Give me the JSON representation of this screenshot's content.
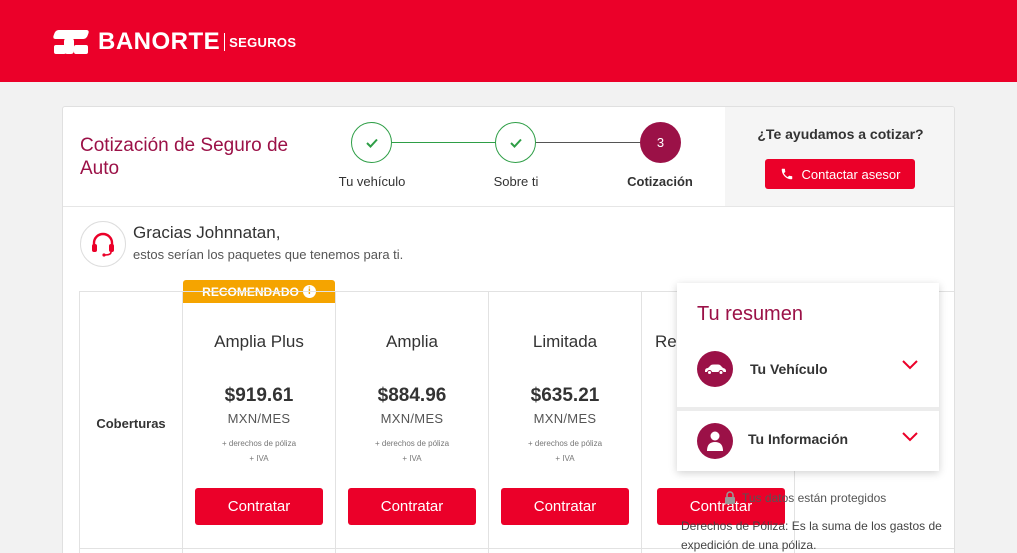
{
  "brand": {
    "name": "BANORTE",
    "sub": "SEGUROS",
    "color": "#eb0029",
    "accent": "#9b1147"
  },
  "header": {
    "title": "Cotización de Seguro de Auto"
  },
  "steps": [
    {
      "label": "Tu vehículo",
      "state": "done",
      "icon": "check-icon"
    },
    {
      "label": "Sobre ti",
      "state": "done",
      "icon": "check-icon"
    },
    {
      "label": "Cotización",
      "state": "active",
      "number": "3"
    }
  ],
  "help": {
    "question": "¿Te ayudamos a cotizar?",
    "button_label": "Contactar asesor",
    "icon": "phone-icon"
  },
  "greeting": {
    "title": "Gracias Johnnatan,",
    "subtitle": "estos serían los paquetes que tenemos para ti.",
    "icon": "headset-icon"
  },
  "table": {
    "row_label": "Coberturas",
    "recommended_badge": "RECOMENDADO",
    "plans": [
      {
        "name": "Amplia Plus",
        "price": "$919.61",
        "unit": "MXN/MES",
        "note1": "+ derechos de póliza",
        "note2": "+ IVA",
        "button": "Contratar"
      },
      {
        "name": "Amplia",
        "price": "$884.96",
        "unit": "MXN/MES",
        "note1": "+ derechos de póliza",
        "note2": "+ IVA",
        "button": "Contratar"
      },
      {
        "name": "Limitada",
        "price": "$635.21",
        "unit": "MXN/MES",
        "note1": "+ derechos de póliza",
        "note2": "+ IVA",
        "button": "Contratar"
      },
      {
        "name": "Res",
        "price": "",
        "unit": "",
        "note1": "",
        "note2": "+",
        "button": "Contratar"
      }
    ]
  },
  "summary": {
    "title": "Tu resumen",
    "items": [
      {
        "label": "Tu Vehículo",
        "icon": "car-icon"
      },
      {
        "label": "Tu Información",
        "icon": "user-icon"
      }
    ]
  },
  "protected_text": "Tus datos están protegidos",
  "footnote": "Derechos de Póliza: Es la suma de los gastos de expedición de una póliza."
}
